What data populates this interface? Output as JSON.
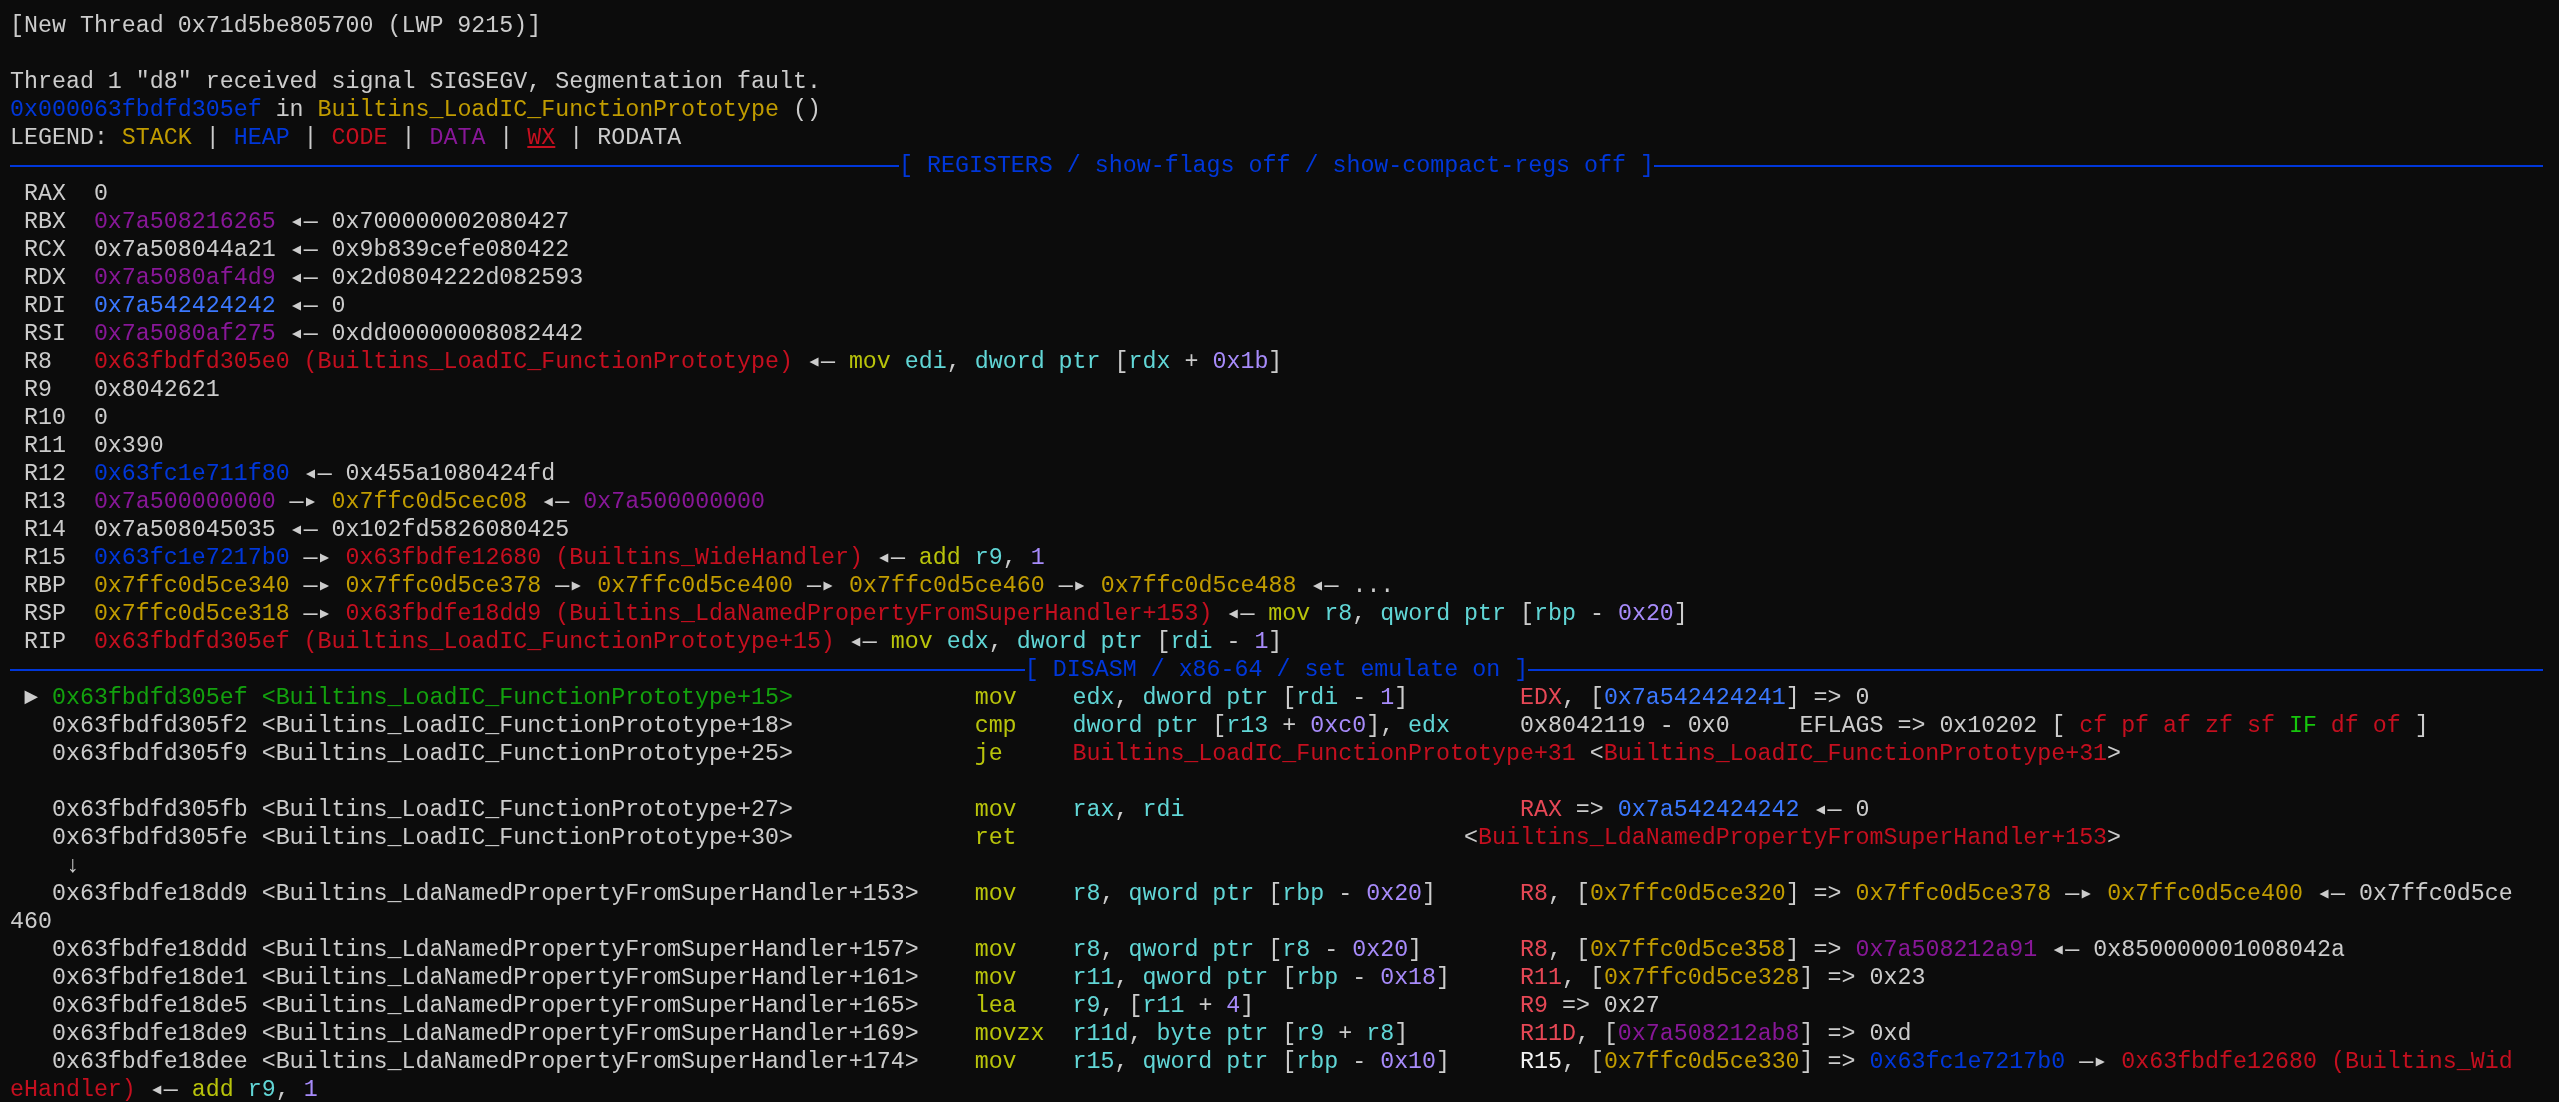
{
  "terminal": {
    "lines": [
      {
        "kind": "text",
        "segments": [
          {
            "text": "[New Thread 0x71d5be805700 (LWP 9215)]",
            "color": "#cccccc"
          }
        ]
      },
      {
        "kind": "blank"
      },
      {
        "kind": "text",
        "segments": [
          {
            "text": "Thread 1 \"d8\" received signal SIGSEGV, Segmentation fault.",
            "color": "#cccccc"
          }
        ]
      },
      {
        "kind": "text",
        "segments": [
          {
            "text": "0x000063fbdfd305ef",
            "color": "#0037da"
          },
          {
            "text": " in ",
            "color": "#cccccc"
          },
          {
            "text": "Builtins_LoadIC_FunctionPrototype",
            "color": "#c19c00"
          },
          {
            "text": " ()",
            "color": "#cccccc"
          }
        ]
      },
      {
        "kind": "legend",
        "segments": [
          {
            "text": "LEGEND: ",
            "color": "#cccccc",
            "underline": false
          },
          {
            "text": "STACK",
            "color": "#c19c00",
            "underline": false
          },
          {
            "text": " | ",
            "color": "#cccccc",
            "underline": false
          },
          {
            "text": "HEAP",
            "color": "#0037da",
            "underline": false
          },
          {
            "text": " | ",
            "color": "#cccccc",
            "underline": false
          },
          {
            "text": "CODE",
            "color": "#c50f1f",
            "underline": false
          },
          {
            "text": " | ",
            "color": "#cccccc",
            "underline": false
          },
          {
            "text": "DATA",
            "color": "#881798",
            "underline": false
          },
          {
            "text": " | ",
            "color": "#cccccc",
            "underline": false
          },
          {
            "text": "WX",
            "color": "#c50f1f",
            "underline": true
          },
          {
            "text": " | ",
            "color": "#cccccc",
            "underline": false
          },
          {
            "text": "RODATA",
            "color": "#cccccc",
            "underline": false
          }
        ]
      },
      {
        "kind": "rule",
        "title": "[ REGISTERS / show-flags off / show-compact-regs off ]"
      },
      {
        "kind": "text",
        "segments": [
          {
            "text": " RAX  0",
            "color": "#cccccc"
          }
        ]
      },
      {
        "kind": "text",
        "segments": [
          {
            "text": " RBX  ",
            "color": "#cccccc"
          },
          {
            "text": "0x7a508216265",
            "color": "#881798"
          },
          {
            "text": " ◂— 0x700000002080427",
            "color": "#cccccc"
          }
        ]
      },
      {
        "kind": "text",
        "segments": [
          {
            "text": " RCX  0x7a508044a21 ◂— 0x9b839cefe080422",
            "color": "#cccccc"
          }
        ]
      },
      {
        "kind": "text",
        "segments": [
          {
            "text": " RDX  ",
            "color": "#cccccc"
          },
          {
            "text": "0x7a5080af4d9",
            "color": "#881798"
          },
          {
            "text": " ◂— 0x2d0804222d082593",
            "color": "#cccccc"
          }
        ]
      },
      {
        "kind": "text",
        "segments": [
          {
            "text": " RDI  ",
            "color": "#cccccc"
          },
          {
            "text": "0x7a542424242",
            "color": "#3b78ff"
          },
          {
            "text": " ◂— 0",
            "color": "#cccccc"
          }
        ]
      },
      {
        "kind": "text",
        "segments": [
          {
            "text": " RSI  ",
            "color": "#cccccc"
          },
          {
            "text": "0x7a5080af275",
            "color": "#881798"
          },
          {
            "text": " ◂— 0xdd00000008082442",
            "color": "#cccccc"
          }
        ]
      },
      {
        "kind": "text",
        "segments": [
          {
            "text": " R8   ",
            "color": "#cccccc"
          },
          {
            "text": "0x63fbdfd305e0 (Builtins_LoadIC_FunctionPrototype)",
            "color": "#c50f1f"
          },
          {
            "text": " ◂— ",
            "color": "#cccccc"
          },
          {
            "text": "mov ",
            "color": "#b9c40b"
          },
          {
            "text": "edi",
            "color": "#61d6d6"
          },
          {
            "text": ", ",
            "color": "#cccccc"
          },
          {
            "text": "dword ptr ",
            "color": "#61d6d6"
          },
          {
            "text": "[",
            "color": "#cccccc"
          },
          {
            "text": "rdx",
            "color": "#61d6d6"
          },
          {
            "text": " + ",
            "color": "#cccccc"
          },
          {
            "text": "0x1b",
            "color": "#a78bfa"
          },
          {
            "text": "]",
            "color": "#cccccc"
          }
        ]
      },
      {
        "kind": "text",
        "segments": [
          {
            "text": " R9   0x8042621",
            "color": "#cccccc"
          }
        ]
      },
      {
        "kind": "text",
        "segments": [
          {
            "text": " R10  0",
            "color": "#cccccc"
          }
        ]
      },
      {
        "kind": "text",
        "segments": [
          {
            "text": " R11  0x390",
            "color": "#cccccc"
          }
        ]
      },
      {
        "kind": "text",
        "segments": [
          {
            "text": " R12  ",
            "color": "#cccccc"
          },
          {
            "text": "0x63fc1e711f80",
            "color": "#0037da"
          },
          {
            "text": " ◂— 0x455a1080424fd",
            "color": "#cccccc"
          }
        ]
      },
      {
        "kind": "text",
        "segments": [
          {
            "text": " R13  ",
            "color": "#cccccc"
          },
          {
            "text": "0x7a500000000",
            "color": "#881798"
          },
          {
            "text": " —▸ ",
            "color": "#cccccc"
          },
          {
            "text": "0x7ffc0d5cec08",
            "color": "#c19c00"
          },
          {
            "text": " ◂— ",
            "color": "#cccccc"
          },
          {
            "text": "0x7a500000000",
            "color": "#881798"
          }
        ]
      },
      {
        "kind": "text",
        "segments": [
          {
            "text": " R14  0x7a508045035 ◂— 0x102fd5826080425",
            "color": "#cccccc"
          }
        ]
      },
      {
        "kind": "text",
        "segments": [
          {
            "text": " R15  ",
            "color": "#cccccc"
          },
          {
            "text": "0x63fc1e7217b0",
            "color": "#0037da"
          },
          {
            "text": " —▸ ",
            "color": "#cccccc"
          },
          {
            "text": "0x63fbdfe12680 (Builtins_WideHandler)",
            "color": "#c50f1f"
          },
          {
            "text": " ◂— ",
            "color": "#cccccc"
          },
          {
            "text": "add ",
            "color": "#b9c40b"
          },
          {
            "text": "r9",
            "color": "#61d6d6"
          },
          {
            "text": ", ",
            "color": "#cccccc"
          },
          {
            "text": "1",
            "color": "#a78bfa"
          }
        ]
      },
      {
        "kind": "text",
        "segments": [
          {
            "text": " RBP  ",
            "color": "#cccccc"
          },
          {
            "text": "0x7ffc0d5ce340",
            "color": "#c19c00"
          },
          {
            "text": " —▸ ",
            "color": "#cccccc"
          },
          {
            "text": "0x7ffc0d5ce378",
            "color": "#c19c00"
          },
          {
            "text": " —▸ ",
            "color": "#cccccc"
          },
          {
            "text": "0x7ffc0d5ce400",
            "color": "#c19c00"
          },
          {
            "text": " —▸ ",
            "color": "#cccccc"
          },
          {
            "text": "0x7ffc0d5ce460",
            "color": "#c19c00"
          },
          {
            "text": " —▸ ",
            "color": "#cccccc"
          },
          {
            "text": "0x7ffc0d5ce488",
            "color": "#c19c00"
          },
          {
            "text": " ◂— ...",
            "color": "#cccccc"
          }
        ]
      },
      {
        "kind": "text",
        "segments": [
          {
            "text": " RSP  ",
            "color": "#cccccc"
          },
          {
            "text": "0x7ffc0d5ce318",
            "color": "#c19c00"
          },
          {
            "text": " —▸ ",
            "color": "#cccccc"
          },
          {
            "text": "0x63fbdfe18dd9 (Builtins_LdaNamedPropertyFromSuperHandler+153)",
            "color": "#c50f1f"
          },
          {
            "text": " ◂— ",
            "color": "#cccccc"
          },
          {
            "text": "mov ",
            "color": "#b9c40b"
          },
          {
            "text": "r8",
            "color": "#61d6d6"
          },
          {
            "text": ", ",
            "color": "#cccccc"
          },
          {
            "text": "qword ptr ",
            "color": "#61d6d6"
          },
          {
            "text": "[",
            "color": "#cccccc"
          },
          {
            "text": "rbp",
            "color": "#61d6d6"
          },
          {
            "text": " - ",
            "color": "#cccccc"
          },
          {
            "text": "0x20",
            "color": "#a78bfa"
          },
          {
            "text": "]",
            "color": "#cccccc"
          }
        ]
      },
      {
        "kind": "text",
        "segments": [
          {
            "text": " RIP  ",
            "color": "#cccccc"
          },
          {
            "text": "0x63fbdfd305ef (Builtins_LoadIC_FunctionPrototype+15)",
            "color": "#c50f1f"
          },
          {
            "text": " ◂— ",
            "color": "#cccccc"
          },
          {
            "text": "mov ",
            "color": "#b9c40b"
          },
          {
            "text": "edx",
            "color": "#61d6d6"
          },
          {
            "text": ", ",
            "color": "#cccccc"
          },
          {
            "text": "dword ptr ",
            "color": "#61d6d6"
          },
          {
            "text": "[",
            "color": "#cccccc"
          },
          {
            "text": "rdi",
            "color": "#61d6d6"
          },
          {
            "text": " - ",
            "color": "#cccccc"
          },
          {
            "text": "1",
            "color": "#a78bfa"
          },
          {
            "text": "]",
            "color": "#cccccc"
          }
        ]
      },
      {
        "kind": "rule",
        "title": "[ DISASM / x86-64 / set emulate on ]"
      },
      {
        "kind": "text",
        "segments": [
          {
            "text": " ► ",
            "color": "#cccccc"
          },
          {
            "text": "0x63fbdfd305ef <Builtins_LoadIC_FunctionPrototype+15>             ",
            "color": "#13a10e"
          },
          {
            "text": "mov    ",
            "color": "#b9c40b"
          },
          {
            "text": "edx",
            "color": "#61d6d6"
          },
          {
            "text": ", ",
            "color": "#cccccc"
          },
          {
            "text": "dword ptr ",
            "color": "#61d6d6"
          },
          {
            "text": "[",
            "color": "#cccccc"
          },
          {
            "text": "rdi",
            "color": "#61d6d6"
          },
          {
            "text": " - ",
            "color": "#cccccc"
          },
          {
            "text": "1",
            "color": "#a78bfa"
          },
          {
            "text": "]        ",
            "color": "#cccccc"
          },
          {
            "text": "EDX",
            "color": "#e74856"
          },
          {
            "text": ", [",
            "color": "#cccccc"
          },
          {
            "text": "0x7a542424241",
            "color": "#3b78ff"
          },
          {
            "text": "] => 0",
            "color": "#cccccc"
          }
        ]
      },
      {
        "kind": "text",
        "segments": [
          {
            "text": "   0x63fbdfd305f2 <Builtins_LoadIC_FunctionPrototype+18>             ",
            "color": "#cccccc"
          },
          {
            "text": "cmp    ",
            "color": "#b9c40b"
          },
          {
            "text": "dword ptr ",
            "color": "#61d6d6"
          },
          {
            "text": "[",
            "color": "#cccccc"
          },
          {
            "text": "r13",
            "color": "#61d6d6"
          },
          {
            "text": " + ",
            "color": "#cccccc"
          },
          {
            "text": "0xc0",
            "color": "#a78bfa"
          },
          {
            "text": "], ",
            "color": "#cccccc"
          },
          {
            "text": "edx",
            "color": "#61d6d6"
          },
          {
            "text": "     0x8042119 - 0x0     EFLAGS => 0x10202 [ ",
            "color": "#cccccc"
          },
          {
            "text": "cf pf af zf sf ",
            "color": "#c50f1f"
          },
          {
            "text": "IF ",
            "color": "#16c60c"
          },
          {
            "text": "df of ",
            "color": "#c50f1f"
          },
          {
            "text": "]",
            "color": "#cccccc"
          }
        ]
      },
      {
        "kind": "text",
        "segments": [
          {
            "text": "   0x63fbdfd305f9 <Builtins_LoadIC_FunctionPrototype+25>             ",
            "color": "#cccccc"
          },
          {
            "text": "je     ",
            "color": "#b9c40b"
          },
          {
            "text": "Builtins_LoadIC_FunctionPrototype+31 ",
            "color": "#c50f1f"
          },
          {
            "text": "<",
            "color": "#cccccc"
          },
          {
            "text": "Builtins_LoadIC_FunctionPrototype+31",
            "color": "#c50f1f"
          },
          {
            "text": ">",
            "color": "#cccccc"
          }
        ]
      },
      {
        "kind": "blank"
      },
      {
        "kind": "text",
        "segments": [
          {
            "text": "   0x63fbdfd305fb <Builtins_LoadIC_FunctionPrototype+27>             ",
            "color": "#cccccc"
          },
          {
            "text": "mov    ",
            "color": "#b9c40b"
          },
          {
            "text": "rax",
            "color": "#61d6d6"
          },
          {
            "text": ", ",
            "color": "#cccccc"
          },
          {
            "text": "rdi                        ",
            "color": "#61d6d6"
          },
          {
            "text": "RAX",
            "color": "#e74856"
          },
          {
            "text": " => ",
            "color": "#cccccc"
          },
          {
            "text": "0x7a542424242",
            "color": "#3b78ff"
          },
          {
            "text": " ◂— 0",
            "color": "#cccccc"
          }
        ]
      },
      {
        "kind": "text",
        "segments": [
          {
            "text": "   0x63fbdfd305fe <Builtins_LoadIC_FunctionPrototype+30>             ",
            "color": "#cccccc"
          },
          {
            "text": "ret                                ",
            "color": "#b9c40b"
          },
          {
            "text": "<",
            "color": "#cccccc"
          },
          {
            "text": "Builtins_LdaNamedPropertyFromSuperHandler+153",
            "color": "#c50f1f"
          },
          {
            "text": ">",
            "color": "#cccccc"
          }
        ]
      },
      {
        "kind": "text",
        "segments": [
          {
            "text": "    ↓",
            "color": "#cccccc"
          }
        ]
      },
      {
        "kind": "text",
        "segments": [
          {
            "text": "   0x63fbdfe18dd9 <Builtins_LdaNamedPropertyFromSuperHandler+153>    ",
            "color": "#cccccc"
          },
          {
            "text": "mov    ",
            "color": "#b9c40b"
          },
          {
            "text": "r8",
            "color": "#61d6d6"
          },
          {
            "text": ", ",
            "color": "#cccccc"
          },
          {
            "text": "qword ptr ",
            "color": "#61d6d6"
          },
          {
            "text": "[",
            "color": "#cccccc"
          },
          {
            "text": "rbp",
            "color": "#61d6d6"
          },
          {
            "text": " - ",
            "color": "#cccccc"
          },
          {
            "text": "0x20",
            "color": "#a78bfa"
          },
          {
            "text": "]      ",
            "color": "#cccccc"
          },
          {
            "text": "R8",
            "color": "#e74856"
          },
          {
            "text": ", [",
            "color": "#cccccc"
          },
          {
            "text": "0x7ffc0d5ce320",
            "color": "#c19c00"
          },
          {
            "text": "] => ",
            "color": "#cccccc"
          },
          {
            "text": "0x7ffc0d5ce378",
            "color": "#c19c00"
          },
          {
            "text": " —▸ ",
            "color": "#cccccc"
          },
          {
            "text": "0x7ffc0d5ce400",
            "color": "#c19c00"
          },
          {
            "text": " ◂— 0x7ffc0d5ce",
            "color": "#cccccc"
          }
        ]
      },
      {
        "kind": "text",
        "segments": [
          {
            "text": "460",
            "color": "#cccccc"
          }
        ]
      },
      {
        "kind": "text",
        "segments": [
          {
            "text": "   0x63fbdfe18ddd <Builtins_LdaNamedPropertyFromSuperHandler+157>    ",
            "color": "#cccccc"
          },
          {
            "text": "mov    ",
            "color": "#b9c40b"
          },
          {
            "text": "r8",
            "color": "#61d6d6"
          },
          {
            "text": ", ",
            "color": "#cccccc"
          },
          {
            "text": "qword ptr ",
            "color": "#61d6d6"
          },
          {
            "text": "[",
            "color": "#cccccc"
          },
          {
            "text": "r8",
            "color": "#61d6d6"
          },
          {
            "text": " - ",
            "color": "#cccccc"
          },
          {
            "text": "0x20",
            "color": "#a78bfa"
          },
          {
            "text": "]       ",
            "color": "#cccccc"
          },
          {
            "text": "R8",
            "color": "#e74856"
          },
          {
            "text": ", [",
            "color": "#cccccc"
          },
          {
            "text": "0x7ffc0d5ce358",
            "color": "#c19c00"
          },
          {
            "text": "] => ",
            "color": "#cccccc"
          },
          {
            "text": "0x7a508212a91",
            "color": "#881798"
          },
          {
            "text": " ◂— 0x850000001008042a",
            "color": "#cccccc"
          }
        ]
      },
      {
        "kind": "text",
        "segments": [
          {
            "text": "   0x63fbdfe18de1 <Builtins_LdaNamedPropertyFromSuperHandler+161>    ",
            "color": "#cccccc"
          },
          {
            "text": "mov    ",
            "color": "#b9c40b"
          },
          {
            "text": "r11",
            "color": "#61d6d6"
          },
          {
            "text": ", ",
            "color": "#cccccc"
          },
          {
            "text": "qword ptr ",
            "color": "#61d6d6"
          },
          {
            "text": "[",
            "color": "#cccccc"
          },
          {
            "text": "rbp",
            "color": "#61d6d6"
          },
          {
            "text": " - ",
            "color": "#cccccc"
          },
          {
            "text": "0x18",
            "color": "#a78bfa"
          },
          {
            "text": "]     ",
            "color": "#cccccc"
          },
          {
            "text": "R11",
            "color": "#e74856"
          },
          {
            "text": ", [",
            "color": "#cccccc"
          },
          {
            "text": "0x7ffc0d5ce328",
            "color": "#c19c00"
          },
          {
            "text": "] => 0x23",
            "color": "#cccccc"
          }
        ]
      },
      {
        "kind": "text",
        "segments": [
          {
            "text": "   0x63fbdfe18de5 <Builtins_LdaNamedPropertyFromSuperHandler+165>    ",
            "color": "#cccccc"
          },
          {
            "text": "lea    ",
            "color": "#b9c40b"
          },
          {
            "text": "r9",
            "color": "#61d6d6"
          },
          {
            "text": ", [",
            "color": "#cccccc"
          },
          {
            "text": "r11",
            "color": "#61d6d6"
          },
          {
            "text": " + ",
            "color": "#cccccc"
          },
          {
            "text": "4",
            "color": "#a78bfa"
          },
          {
            "text": "]                   ",
            "color": "#cccccc"
          },
          {
            "text": "R9",
            "color": "#e74856"
          },
          {
            "text": " => 0x27",
            "color": "#cccccc"
          }
        ]
      },
      {
        "kind": "text",
        "segments": [
          {
            "text": "   0x63fbdfe18de9 <Builtins_LdaNamedPropertyFromSuperHandler+169>    ",
            "color": "#cccccc"
          },
          {
            "text": "movzx  ",
            "color": "#b9c40b"
          },
          {
            "text": "r11d",
            "color": "#61d6d6"
          },
          {
            "text": ", ",
            "color": "#cccccc"
          },
          {
            "text": "byte ptr ",
            "color": "#61d6d6"
          },
          {
            "text": "[",
            "color": "#cccccc"
          },
          {
            "text": "r9",
            "color": "#61d6d6"
          },
          {
            "text": " + ",
            "color": "#cccccc"
          },
          {
            "text": "r8",
            "color": "#61d6d6"
          },
          {
            "text": "]        ",
            "color": "#cccccc"
          },
          {
            "text": "R11D",
            "color": "#e74856"
          },
          {
            "text": ", [",
            "color": "#cccccc"
          },
          {
            "text": "0x7a508212ab8",
            "color": "#881798"
          },
          {
            "text": "] => 0xd",
            "color": "#cccccc"
          }
        ]
      },
      {
        "kind": "text",
        "segments": [
          {
            "text": "   0x63fbdfe18dee <Builtins_LdaNamedPropertyFromSuperHandler+174>    ",
            "color": "#cccccc"
          },
          {
            "text": "mov    ",
            "color": "#b9c40b"
          },
          {
            "text": "r15",
            "color": "#61d6d6"
          },
          {
            "text": ", ",
            "color": "#cccccc"
          },
          {
            "text": "qword ptr ",
            "color": "#61d6d6"
          },
          {
            "text": "[",
            "color": "#cccccc"
          },
          {
            "text": "rbp",
            "color": "#61d6d6"
          },
          {
            "text": " - ",
            "color": "#cccccc"
          },
          {
            "text": "0x10",
            "color": "#a78bfa"
          },
          {
            "text": "]     ",
            "color": "#cccccc"
          },
          {
            "text": "R15",
            "color": "#f2f2f2"
          },
          {
            "text": ", [",
            "color": "#cccccc"
          },
          {
            "text": "0x7ffc0d5ce330",
            "color": "#c19c00"
          },
          {
            "text": "] => ",
            "color": "#cccccc"
          },
          {
            "text": "0x63fc1e7217b0",
            "color": "#0037da"
          },
          {
            "text": " —▸ ",
            "color": "#cccccc"
          },
          {
            "text": "0x63fbdfe12680 (Builtins_Wid",
            "color": "#c50f1f"
          }
        ]
      },
      {
        "kind": "text",
        "segments": [
          {
            "text": "eHandler)",
            "color": "#c50f1f"
          },
          {
            "text": " ◂— ",
            "color": "#cccccc"
          },
          {
            "text": "add ",
            "color": "#b9c40b"
          },
          {
            "text": "r9",
            "color": "#61d6d6"
          },
          {
            "text": ", ",
            "color": "#cccccc"
          },
          {
            "text": "1",
            "color": "#a78bfa"
          }
        ]
      }
    ]
  }
}
